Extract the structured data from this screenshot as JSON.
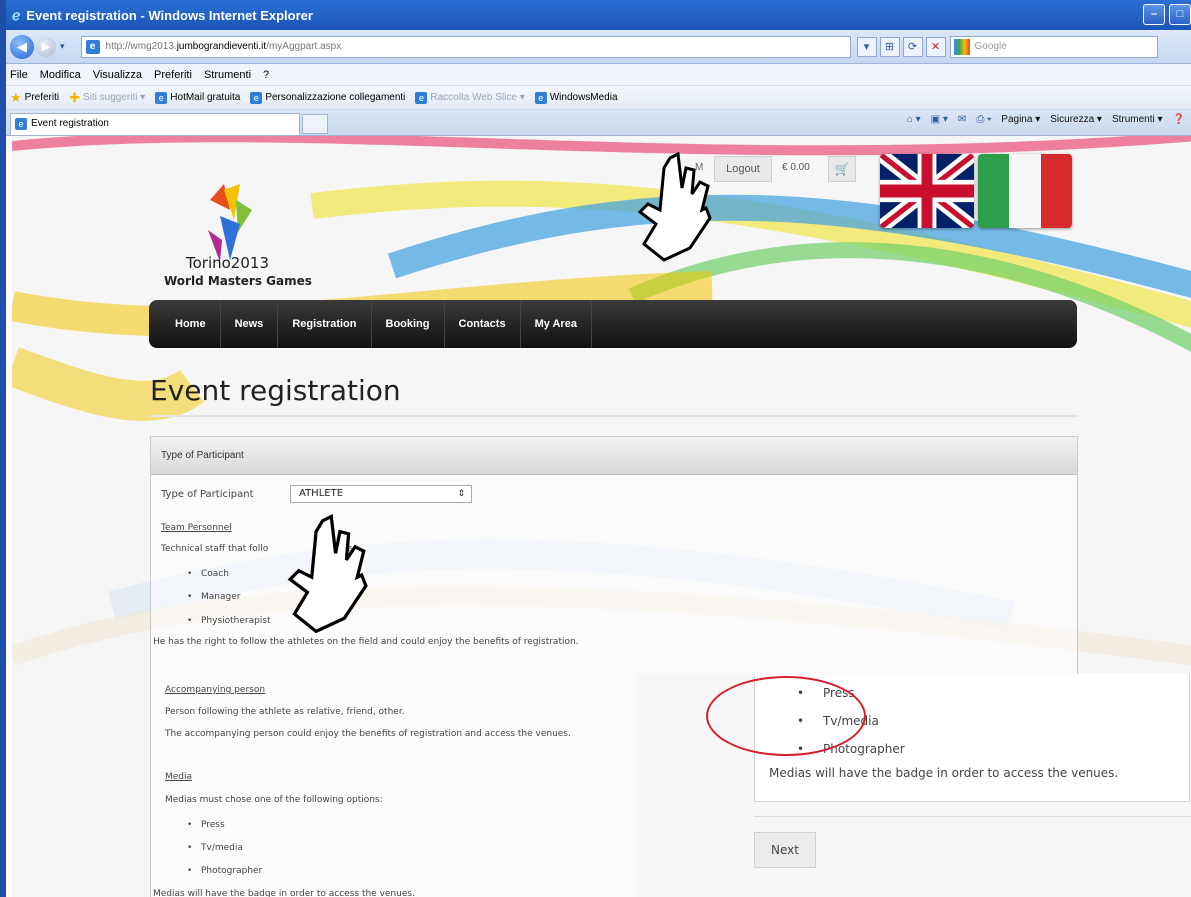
{
  "browser": {
    "window_title": "Event registration - Windows Internet Explorer",
    "url_prefix": "http://wmg2013.",
    "url_domain": "jumbograndieventi.it",
    "url_path": "/myAggpart.aspx",
    "search_placeholder": "Google",
    "menu": [
      "File",
      "Modifica",
      "Visualizza",
      "Preferiti",
      "Strumenti",
      "?"
    ],
    "favorites_label": "Preferiti",
    "favorites": [
      "Siti suggeriti ▾",
      "HotMail gratuita",
      "Personalizzazione collegamenti",
      "Raccolta Web Slice ▾",
      "WindowsMedia"
    ],
    "tab_label": "Event registration",
    "commands": [
      "Pagina ▾",
      "Sicurezza ▾",
      "Strumenti ▾"
    ]
  },
  "site": {
    "logo_line1": "Torino2013",
    "logo_line2": "World Masters Games",
    "hidden_link": "M",
    "logout_label": "Logout",
    "cart_amount": "€ 0.00",
    "nav": [
      "Home",
      "News",
      "Registration",
      "Booking",
      "Contacts",
      "My Area"
    ],
    "page_title": "Event registration"
  },
  "panel": {
    "header": "Type of Participant",
    "type_label": "Type of Participant",
    "type_value": "ATHLETE",
    "team_title": "Team Personnel",
    "team_intro": "Technical staff that follo",
    "team_intro_end": "s:",
    "team_roles": [
      "Coach",
      "Manager",
      "Physiotherapist"
    ],
    "team_note": "He has the right to follow the athletes on the field and could enjoy the benefits of registration.",
    "accomp_title": "Accompanying person",
    "accomp_line1": "Person following the athlete as relative, friend, other.",
    "accomp_line2": "The accompanying person could enjoy the benefits of registration and access the venues.",
    "media_title": "Media",
    "media_intro": "Medias must chose one of the following options:",
    "media_options": [
      "Press",
      "Tv/media",
      "Photographer"
    ],
    "media_note": "Medias will have the badge in order to access the venues."
  },
  "zoom": {
    "media_options": [
      "Press",
      "Tv/media",
      "Photographer"
    ],
    "media_note": "Medias will have the badge in order to access the venues.",
    "next_label": "Next"
  },
  "colors": {
    "annotation": "#d61d2c",
    "navbar": "#1a1a1a"
  }
}
